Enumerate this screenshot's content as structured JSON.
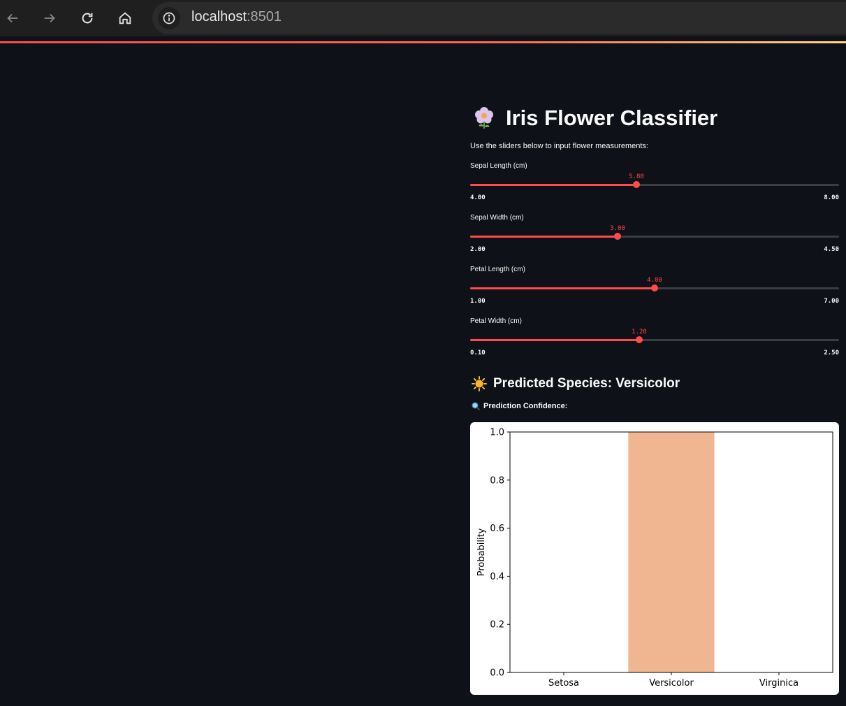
{
  "browser": {
    "url_host": "localhost",
    "url_port": ":8501"
  },
  "app": {
    "title": "Iris Flower Classifier",
    "title_icon": "cherry-blossom-emoji",
    "instructions": "Use the sliders below to input flower measurements:",
    "accent_color": "#ff4b4b",
    "background_color": "#0e1117"
  },
  "sliders": [
    {
      "label": "Sepal Length (cm)",
      "value": 5.8,
      "value_text": "5.80",
      "min": 4.0,
      "max": 8.0,
      "min_text": "4.00",
      "max_text": "8.00"
    },
    {
      "label": "Sepal Width (cm)",
      "value": 3.0,
      "value_text": "3.00",
      "min": 2.0,
      "max": 4.5,
      "min_text": "2.00",
      "max_text": "4.50"
    },
    {
      "label": "Petal Length (cm)",
      "value": 4.0,
      "value_text": "4.00",
      "min": 1.0,
      "max": 7.0,
      "min_text": "1.00",
      "max_text": "7.00"
    },
    {
      "label": "Petal Width (cm)",
      "value": 1.2,
      "value_text": "1.20",
      "min": 0.1,
      "max": 2.5,
      "min_text": "0.10",
      "max_text": "2.50"
    }
  ],
  "result": {
    "predicted_text": "Predicted Species: Versicolor",
    "predicted_icon": "sun-emoji",
    "confidence_label": "Prediction Confidence:",
    "confidence_icon": "magnifying-glass-emoji"
  },
  "chart_data": {
    "type": "bar",
    "categories": [
      "Setosa",
      "Versicolor",
      "Virginica"
    ],
    "values": [
      0.0,
      1.0,
      0.0
    ],
    "colors": [
      "#4c72b0",
      "#f0b692",
      "#55a868"
    ],
    "title": "",
    "xlabel": "",
    "ylabel": "Probability",
    "ylim": [
      0,
      1
    ],
    "yticks": [
      "0.0",
      "0.2",
      "0.4",
      "0.6",
      "0.8",
      "1.0"
    ],
    "grid": false
  }
}
